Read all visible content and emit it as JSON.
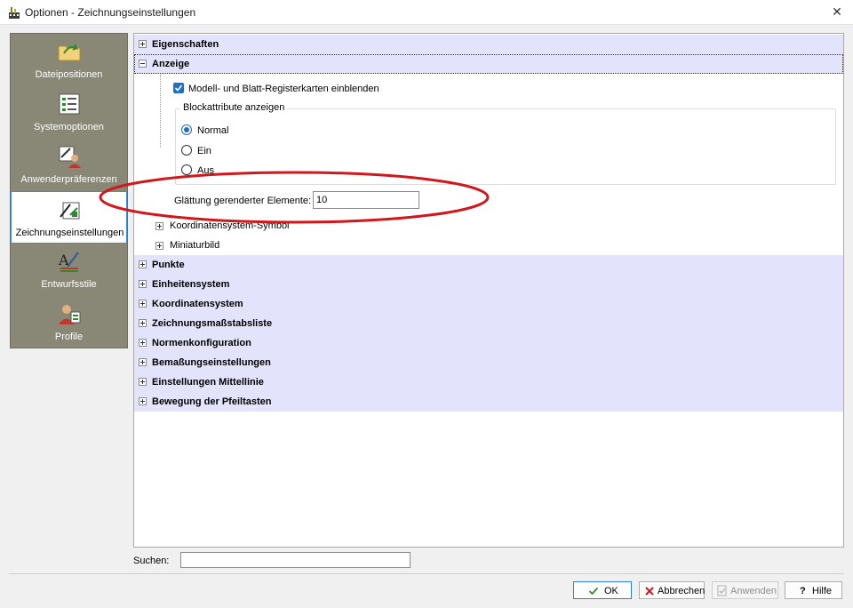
{
  "window": {
    "title": "Optionen - Zeichnungseinstellungen",
    "close_glyph": "✕"
  },
  "sidebar": {
    "items": [
      {
        "label": "Dateipositionen",
        "icon": "folder-arrow-icon"
      },
      {
        "label": "Systemoptionen",
        "icon": "checklist-icon"
      },
      {
        "label": "Anwenderpräferenzen",
        "icon": "user-tools-icon"
      },
      {
        "label": "Zeichnungseinstellungen",
        "icon": "drawing-settings-icon",
        "selected": true
      },
      {
        "label": "Entwurfsstile",
        "icon": "drafting-style-icon"
      },
      {
        "label": "Profile",
        "icon": "profile-user-icon"
      }
    ]
  },
  "tree": {
    "eigenschaften": "Eigenschaften",
    "anzeige": "Anzeige",
    "tabs_checkbox": {
      "label": "Modell- und Blatt-Registerkarten einblenden",
      "checked": true
    },
    "block_group": {
      "title": "Blockattribute anzeigen",
      "options": [
        "Normal",
        "Ein",
        "Aus"
      ],
      "selected": "Normal"
    },
    "smoothing": {
      "label": "Glättung gerenderter Elemente:",
      "value": "10"
    },
    "sub_nodes": [
      "Koordinatensystem-Symbol",
      "Miniaturbild"
    ],
    "categories": [
      "Punkte",
      "Einheitensystem",
      "Koordinatensystem",
      "Zeichnungsmaßstabsliste",
      "Normenkonfiguration",
      "Bemaßungseinstellungen",
      "Einstellungen Mittellinie",
      "Bewegung der Pfeiltasten"
    ]
  },
  "search": {
    "label": "Suchen:",
    "value": ""
  },
  "buttons": {
    "ok": "OK",
    "cancel": "Abbrechen",
    "apply": "Anwenden",
    "help": "Hilfe"
  },
  "colors": {
    "category_bg": "#e3e4fb",
    "sidebar_bg": "#898876",
    "accent": "#1f6fc5",
    "annotation": "#d0181c"
  }
}
